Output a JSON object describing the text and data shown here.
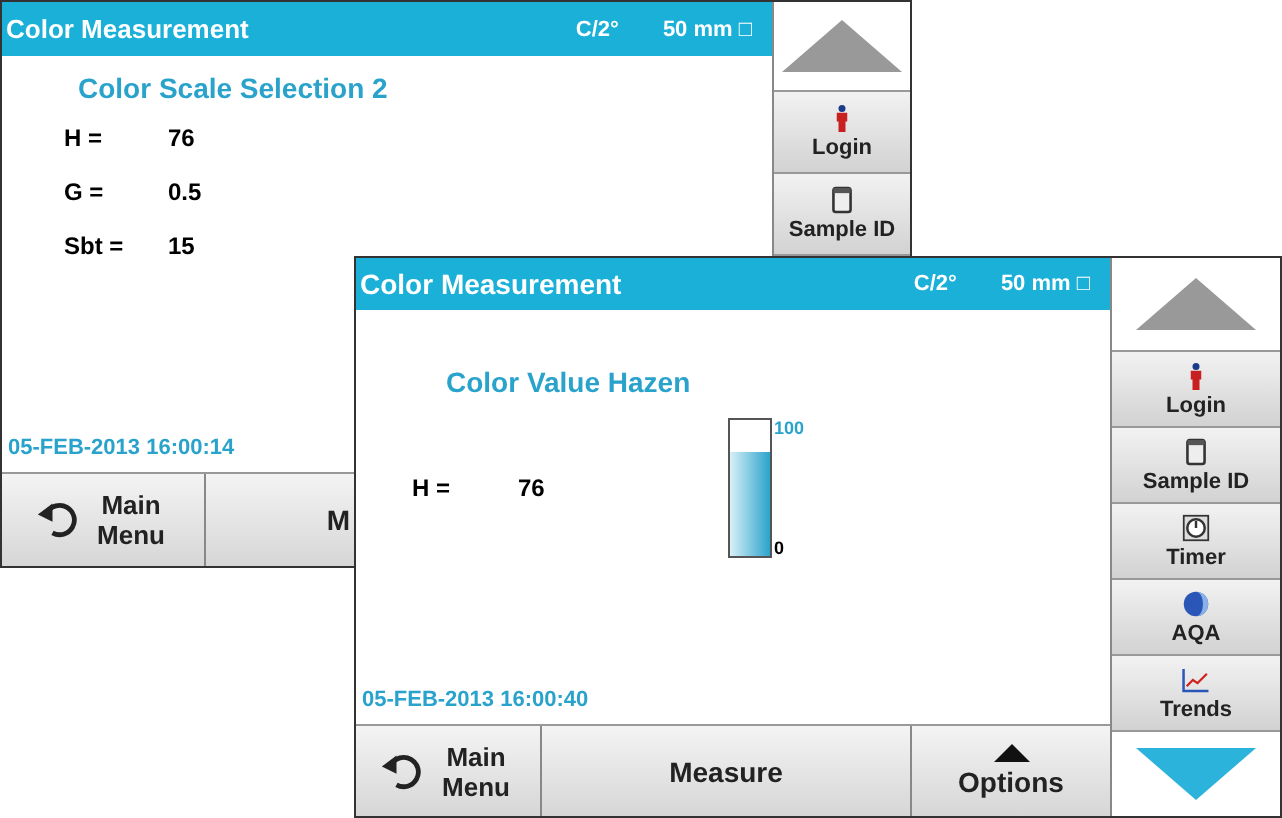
{
  "screens": [
    {
      "title": "Color Measurement",
      "status": [
        "C/2°",
        "50 mm □"
      ],
      "heading": "Color Scale Selection 2",
      "readings": [
        {
          "label": "H =",
          "value": "76"
        },
        {
          "label": "G =",
          "value": "0.5"
        },
        {
          "label": "Sbt =",
          "value": "15"
        }
      ],
      "timestamp": "05-FEB-2013 16:00:14",
      "side_buttons": [
        {
          "kind": "up"
        },
        {
          "kind": "login",
          "label": "Login"
        },
        {
          "kind": "sample",
          "label": "Sample ID"
        }
      ],
      "bottom_buttons": [
        {
          "kind": "back",
          "label": "Main Menu"
        },
        {
          "kind": "plain",
          "label": "M"
        }
      ]
    },
    {
      "title": "Color Measurement",
      "status": [
        "C/2°",
        "50 mm □"
      ],
      "heading": "Color Value Hazen",
      "readings": [
        {
          "label": "H =",
          "value": "76"
        }
      ],
      "gauge": {
        "level": 0.76,
        "max_label": "100",
        "min_label": "0"
      },
      "timestamp": "05-FEB-2013 16:00:40",
      "side_buttons": [
        {
          "kind": "up"
        },
        {
          "kind": "login",
          "label": "Login"
        },
        {
          "kind": "sample",
          "label": "Sample ID"
        },
        {
          "kind": "timer",
          "label": "Timer"
        },
        {
          "kind": "aqa",
          "label": "AQA"
        },
        {
          "kind": "trends",
          "label": "Trends"
        },
        {
          "kind": "down"
        }
      ],
      "bottom_buttons": [
        {
          "kind": "back",
          "label": "Main Menu"
        },
        {
          "kind": "plain",
          "label": "Measure"
        },
        {
          "kind": "options",
          "label": "Options"
        }
      ]
    }
  ]
}
